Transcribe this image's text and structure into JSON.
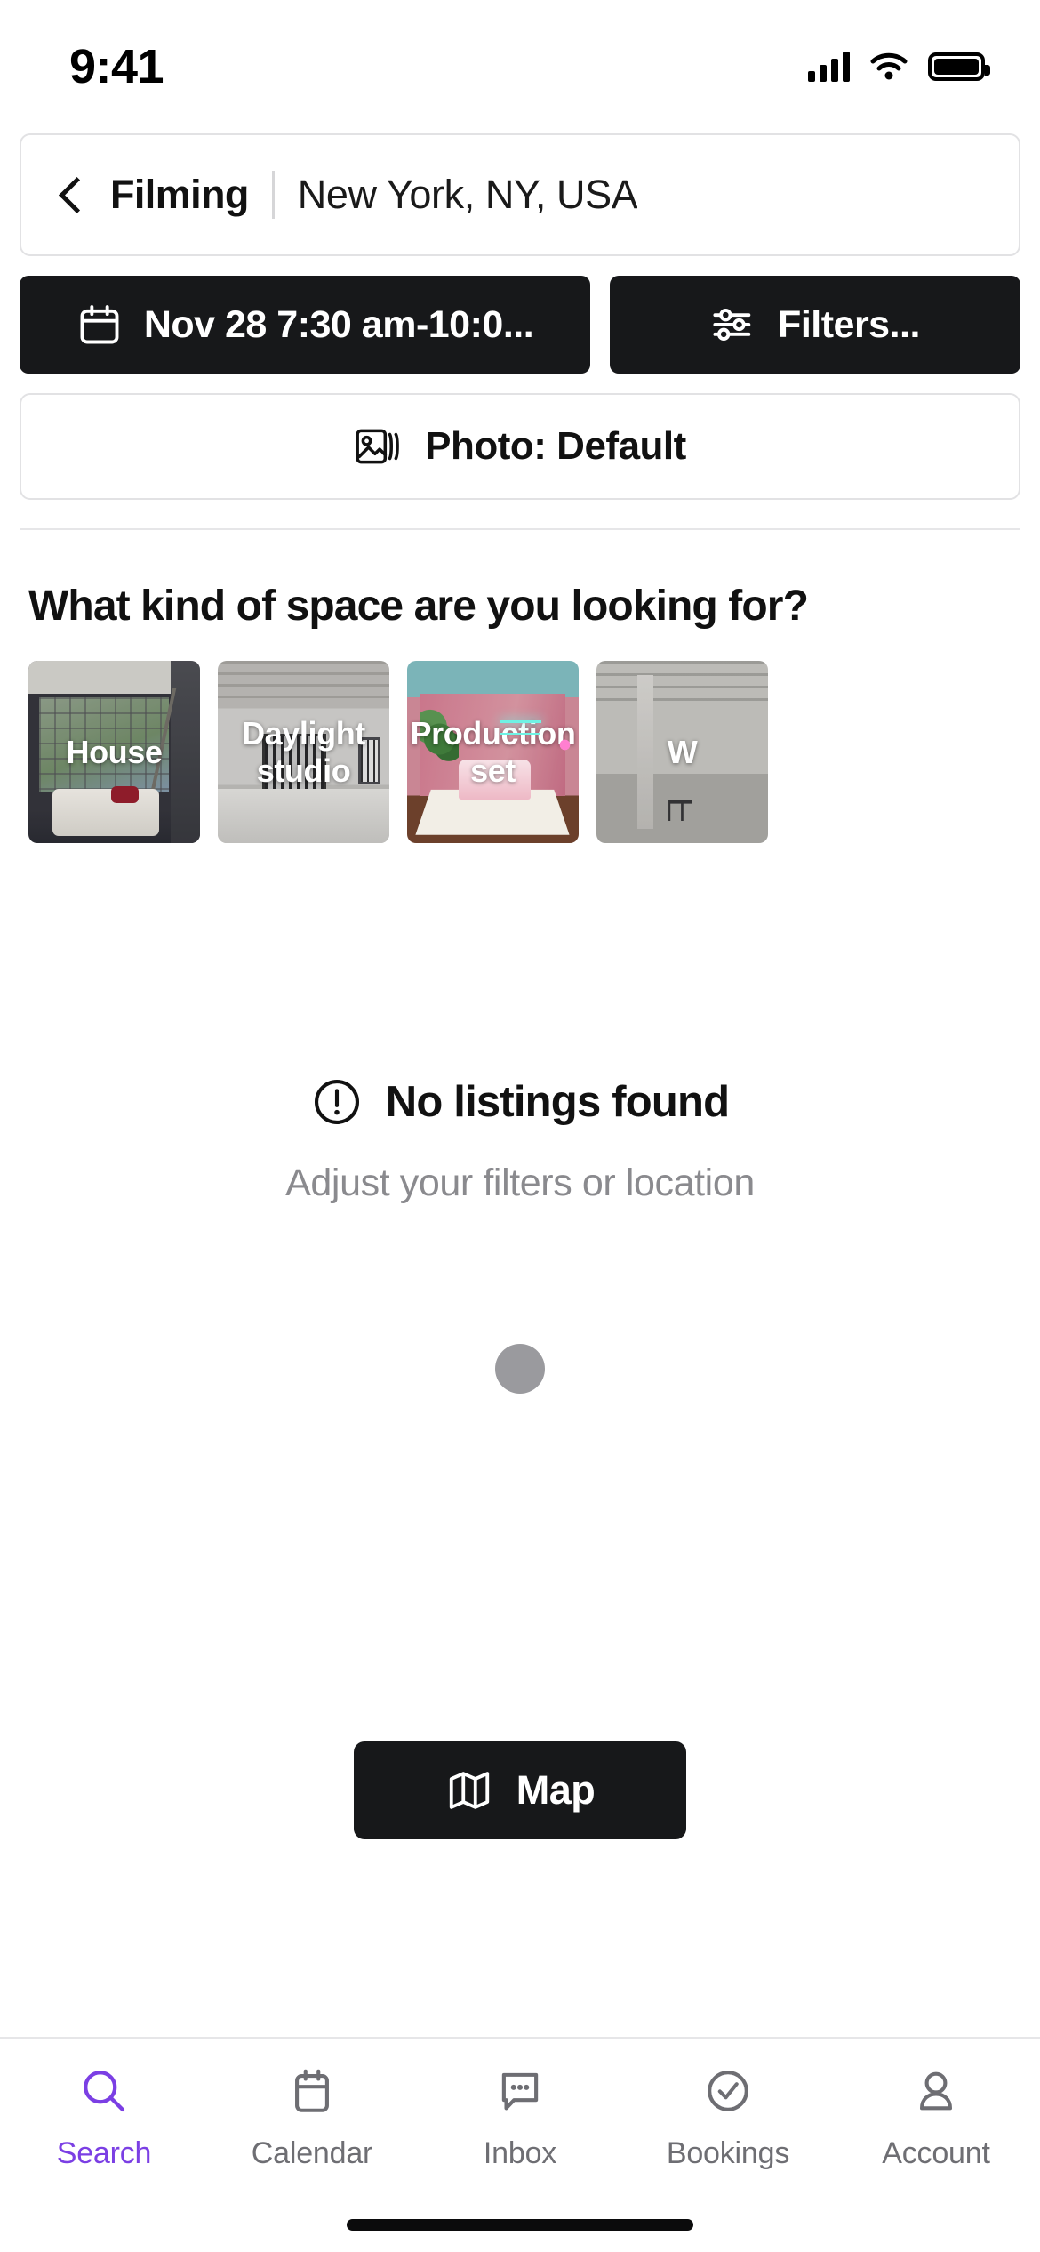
{
  "status_bar": {
    "time": "9:41",
    "cellular_icon": "cellular-bars-icon",
    "wifi_icon": "wifi-icon",
    "battery_icon": "battery-full-icon"
  },
  "header": {
    "back_icon": "chevron-left-icon",
    "search_mode": "Filming",
    "location": "New York, NY, USA",
    "date_button": {
      "icon": "calendar-icon",
      "label": "Nov 28 7:30 am-10:0..."
    },
    "filters_button": {
      "icon": "sliders-icon",
      "label": "Filters..."
    },
    "photo_button": {
      "icon": "photo-stack-icon",
      "label": "Photo: Default"
    }
  },
  "categories": {
    "title": "What kind of space are you looking for?",
    "items": [
      {
        "label": "House",
        "photo": "house-interior-windows"
      },
      {
        "label": "Daylight studio",
        "photo": "white-loft-studio"
      },
      {
        "label": "Production set",
        "photo": "pink-neon-bedroom-set"
      },
      {
        "label": "W",
        "photo": "warehouse-interior"
      }
    ]
  },
  "empty_state": {
    "icon": "exclamation-circle-icon",
    "title": "No listings found",
    "subtitle": "Adjust your filters or location",
    "loading_indicator": "loading-dot"
  },
  "map_button": {
    "icon": "map-icon",
    "label": "Map"
  },
  "tab_bar": {
    "active_color": "#7B3FE4",
    "inactive_color": "#6E6E73",
    "items": [
      {
        "label": "Search",
        "icon": "search-icon",
        "active": true
      },
      {
        "label": "Calendar",
        "icon": "calendar-icon",
        "active": false
      },
      {
        "label": "Inbox",
        "icon": "chat-bubble-icon",
        "active": false
      },
      {
        "label": "Bookings",
        "icon": "check-circle-icon",
        "active": false
      },
      {
        "label": "Account",
        "icon": "person-icon",
        "active": false
      }
    ]
  }
}
